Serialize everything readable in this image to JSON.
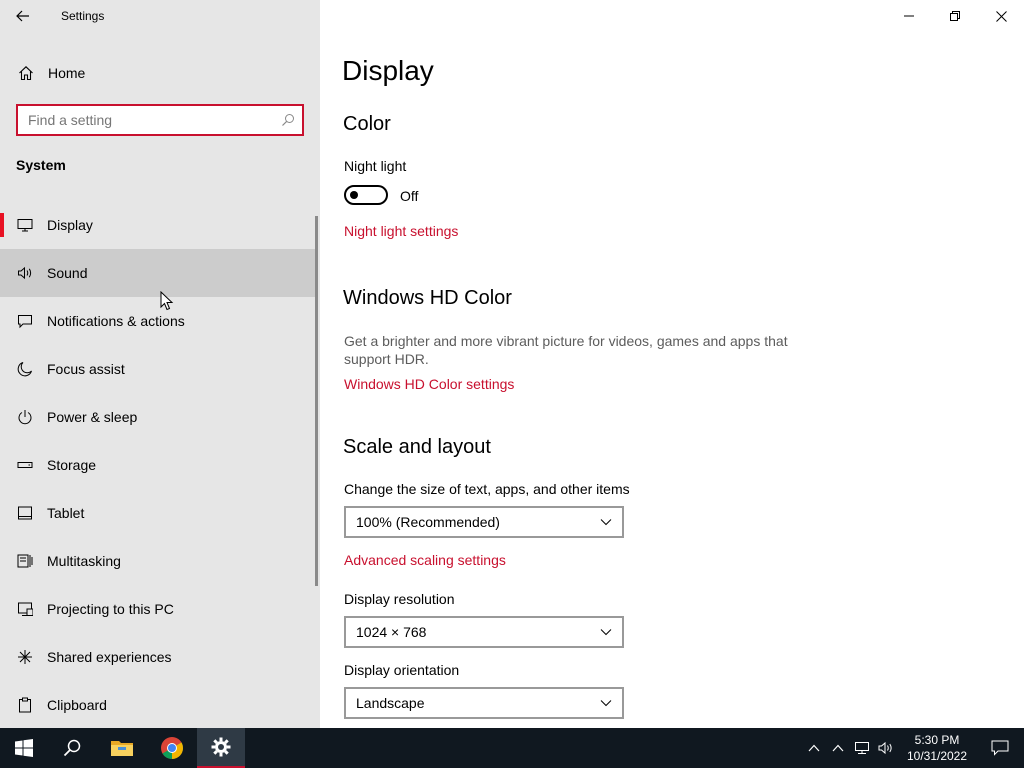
{
  "window": {
    "title": "Settings",
    "controls": [
      "minimize-icon",
      "restore-icon",
      "close-icon"
    ]
  },
  "sidebar": {
    "home_label": "Home",
    "search_placeholder": "Find a setting",
    "section_title": "System",
    "items": [
      {
        "label": "Display",
        "icon": "monitor-icon",
        "selected": true
      },
      {
        "label": "Sound",
        "icon": "speaker-icon",
        "hover": true
      },
      {
        "label": "Notifications & actions",
        "icon": "message-icon"
      },
      {
        "label": "Focus assist",
        "icon": "moon-icon"
      },
      {
        "label": "Power & sleep",
        "icon": "power-icon"
      },
      {
        "label": "Storage",
        "icon": "drive-icon"
      },
      {
        "label": "Tablet",
        "icon": "tablet-icon"
      },
      {
        "label": "Multitasking",
        "icon": "multitask-icon"
      },
      {
        "label": "Projecting to this PC",
        "icon": "projector-icon"
      },
      {
        "label": "Shared experiences",
        "icon": "share-icon"
      },
      {
        "label": "Clipboard",
        "icon": "clipboard-icon"
      }
    ]
  },
  "main": {
    "page_title": "Display",
    "color": {
      "heading": "Color",
      "night_light_label": "Night light",
      "night_light_state": "Off",
      "night_light_link": "Night light settings"
    },
    "hdr": {
      "heading": "Windows HD Color",
      "description": "Get a brighter and more vibrant picture for videos, games and apps that support HDR.",
      "link": "Windows HD Color settings"
    },
    "scale": {
      "heading": "Scale and layout",
      "size_label": "Change the size of text, apps, and other items",
      "size_value": "100% (Recommended)",
      "advanced_link": "Advanced scaling settings",
      "resolution_label": "Display resolution",
      "resolution_value": "1024 × 768",
      "orientation_label": "Display orientation",
      "orientation_value": "Landscape"
    }
  },
  "taskbar": {
    "apps": [
      "windows-start-icon",
      "search-icon",
      "file-explorer-icon",
      "chrome-icon",
      "settings-gear-icon"
    ],
    "clock_time": "5:30 PM",
    "clock_date": "10/31/2022"
  },
  "colors": {
    "accent": "#c8102e",
    "selection_bar": "#e81123",
    "sidebar_bg": "#e6e6e6",
    "taskbar_bg": "#101820"
  }
}
